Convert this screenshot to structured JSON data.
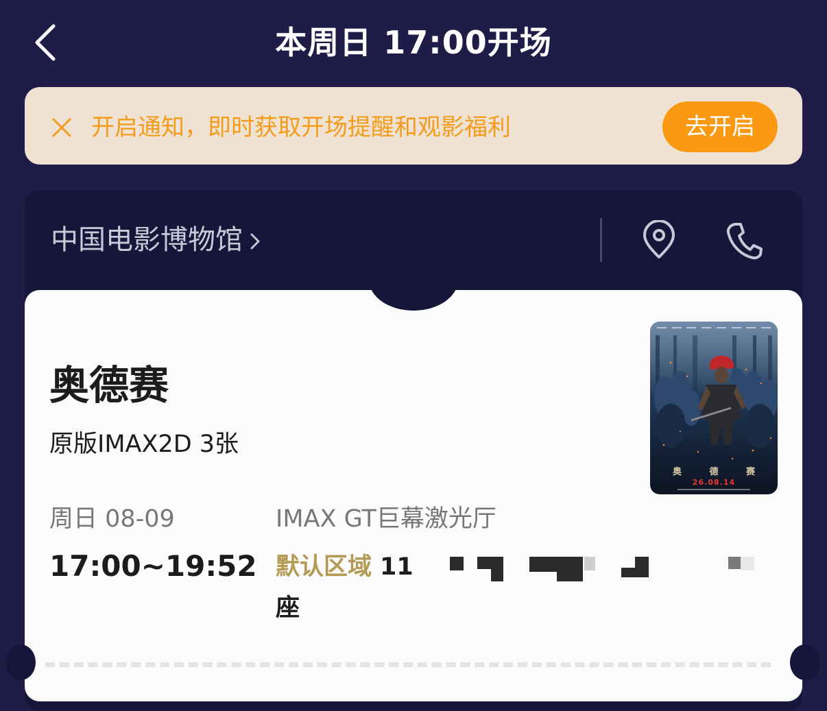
{
  "header": {
    "title": "本周日 17:00开场",
    "back_icon": "chevron-left-icon"
  },
  "notice": {
    "close_icon": "close-icon",
    "text": "开启通知，即时获取开场提醒和观影福利",
    "button_label": "去开启",
    "text_color": "#f39c1c",
    "button_color": "#fb9a12",
    "background": "#efe2d2"
  },
  "cinema": {
    "name": "中国电影博物馆",
    "chevron_icon": "chevron-right-icon",
    "location_icon": "location-pin-icon",
    "phone_icon": "phone-icon"
  },
  "ticket": {
    "movie_title": "奥德赛",
    "format": "原版IMAX2D 3张",
    "date": "周日 08-09",
    "time_range": "17:00~19:52",
    "hall": "IMAX GT巨幕激光厅",
    "seat_area": "默认区域",
    "seat_number": "11",
    "seat_suffix": "座",
    "seat_area_color": "#b39a55",
    "poster": {
      "title": "奥 德 赛",
      "date": "26.08.14"
    }
  },
  "colors": {
    "page_background": "#1f1d47",
    "card_background": "#16153a",
    "ticket_background": "#fbfbfb"
  }
}
